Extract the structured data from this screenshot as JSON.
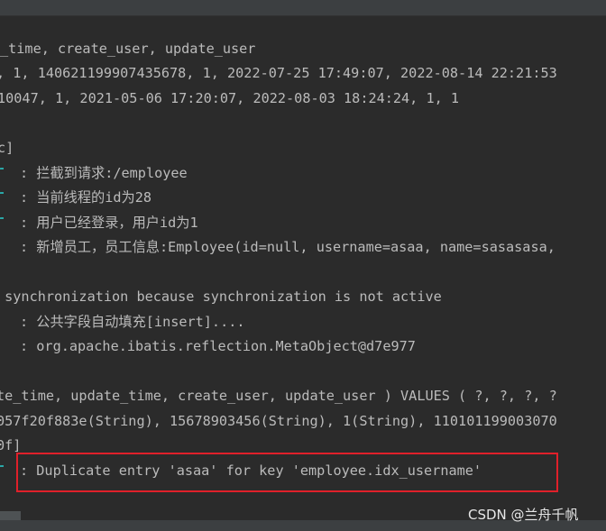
{
  "console": {
    "lines": [
      "_time, create_user, update_user",
      ", 1, 1406211999074356​78, 1, 2022-07-25 17:49:07, 2022-08-14 22:21:53",
      "10047, 1, 2021-05-06 17:20:07, 2022-08-03 18:24:24, 1, 1",
      "c]",
      ": 拦截到请求:/employee",
      ": 当前线程的id为28",
      ": 用户已经登录，用户id为1",
      ": 新增员工，员工信息:Employee(id=null, username=asaa, name=sasasasa,",
      " synchronization because synchronization is not active",
      ": 公共字段自动填充[insert]....",
      ": org.apache.ibatis.reflection.MetaObject@d7e977",
      "te_time, update_time, create_user, update_user ) VALUES ( ?, ?, ?, ?",
      "057f20f883e(String), 15678903456(String), 1(String), 110101199003070",
      "0f]",
      ": Duplicate entry 'asaa' for key 'employee.idx_username'"
    ]
  },
  "watermark": "CSDN @兰舟千帆",
  "colors": {
    "background": "#2b2b2b",
    "text": "#bbbbbb",
    "error_highlight": "#e0202a",
    "marker": "#2aa7a7"
  }
}
